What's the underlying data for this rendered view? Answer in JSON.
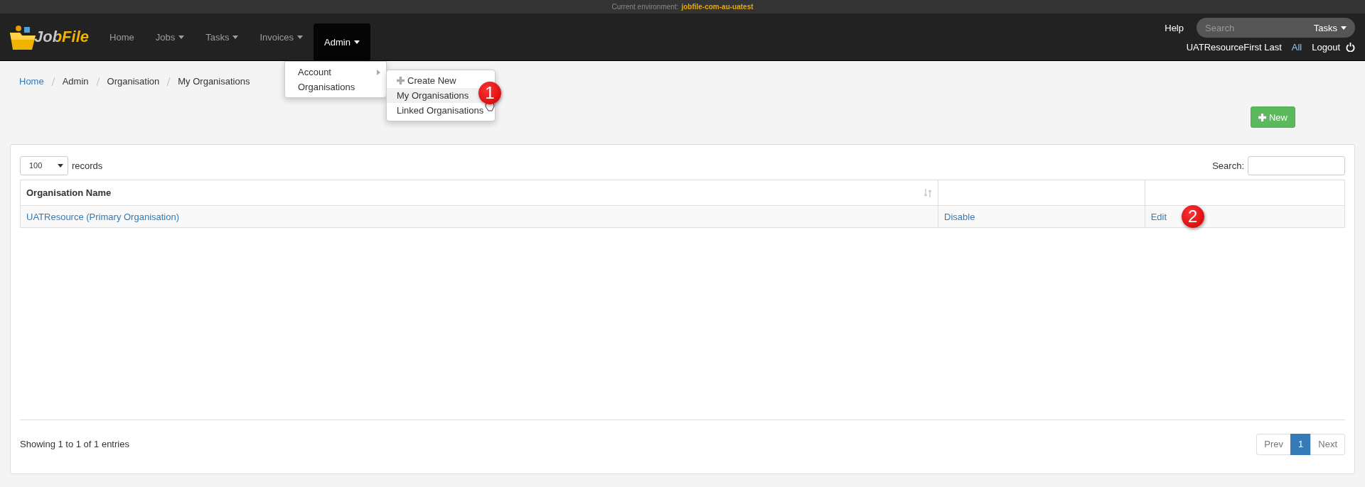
{
  "environment": {
    "label": "Current environment:",
    "value": "jobfile-com-au-uatest"
  },
  "navbar": {
    "logo": "JobFile",
    "items": [
      {
        "label": "Home",
        "caret": false,
        "selected": false
      },
      {
        "label": "Jobs",
        "caret": true,
        "selected": false
      },
      {
        "label": "Tasks",
        "caret": true,
        "selected": false
      },
      {
        "label": "Invoices",
        "caret": true,
        "selected": false
      },
      {
        "label": "Admin",
        "caret": true,
        "selected": true
      }
    ],
    "help": "Help",
    "search": {
      "placeholder": "Search",
      "scope": "Tasks"
    },
    "user": "UATResourceFirst Last",
    "all": "All",
    "logout": "Logout"
  },
  "admin_menu": {
    "items": [
      {
        "label": "Account",
        "submenu": true
      },
      {
        "label": "Organisations",
        "submenu": false
      }
    ]
  },
  "organisations_menu": {
    "callout": "1",
    "items": [
      {
        "kind": "add",
        "label": "Create New",
        "selected": false
      },
      {
        "kind": "link",
        "label": "My Organisations",
        "selected": true
      },
      {
        "kind": "link",
        "label": "Linked Organisations",
        "selected": false
      }
    ]
  },
  "breadcrumb": [
    "Home",
    "Admin",
    "Organisation",
    "My Organisations"
  ],
  "new_button": "New",
  "table": {
    "page_size": "100",
    "records_label": "records",
    "search_label": "Search:",
    "columns": [
      "Organisation Name"
    ],
    "rows": [
      {
        "name": "UATResource (Primary Organisation)",
        "disable": "Disable",
        "edit": "Edit",
        "callout": "2"
      }
    ],
    "summary": "Showing 1 to 1 of 1 entries",
    "pagination": [
      {
        "label": "Prev",
        "selected": false
      },
      {
        "label": "1",
        "selected": true
      },
      {
        "label": "Next",
        "selected": false
      }
    ]
  }
}
